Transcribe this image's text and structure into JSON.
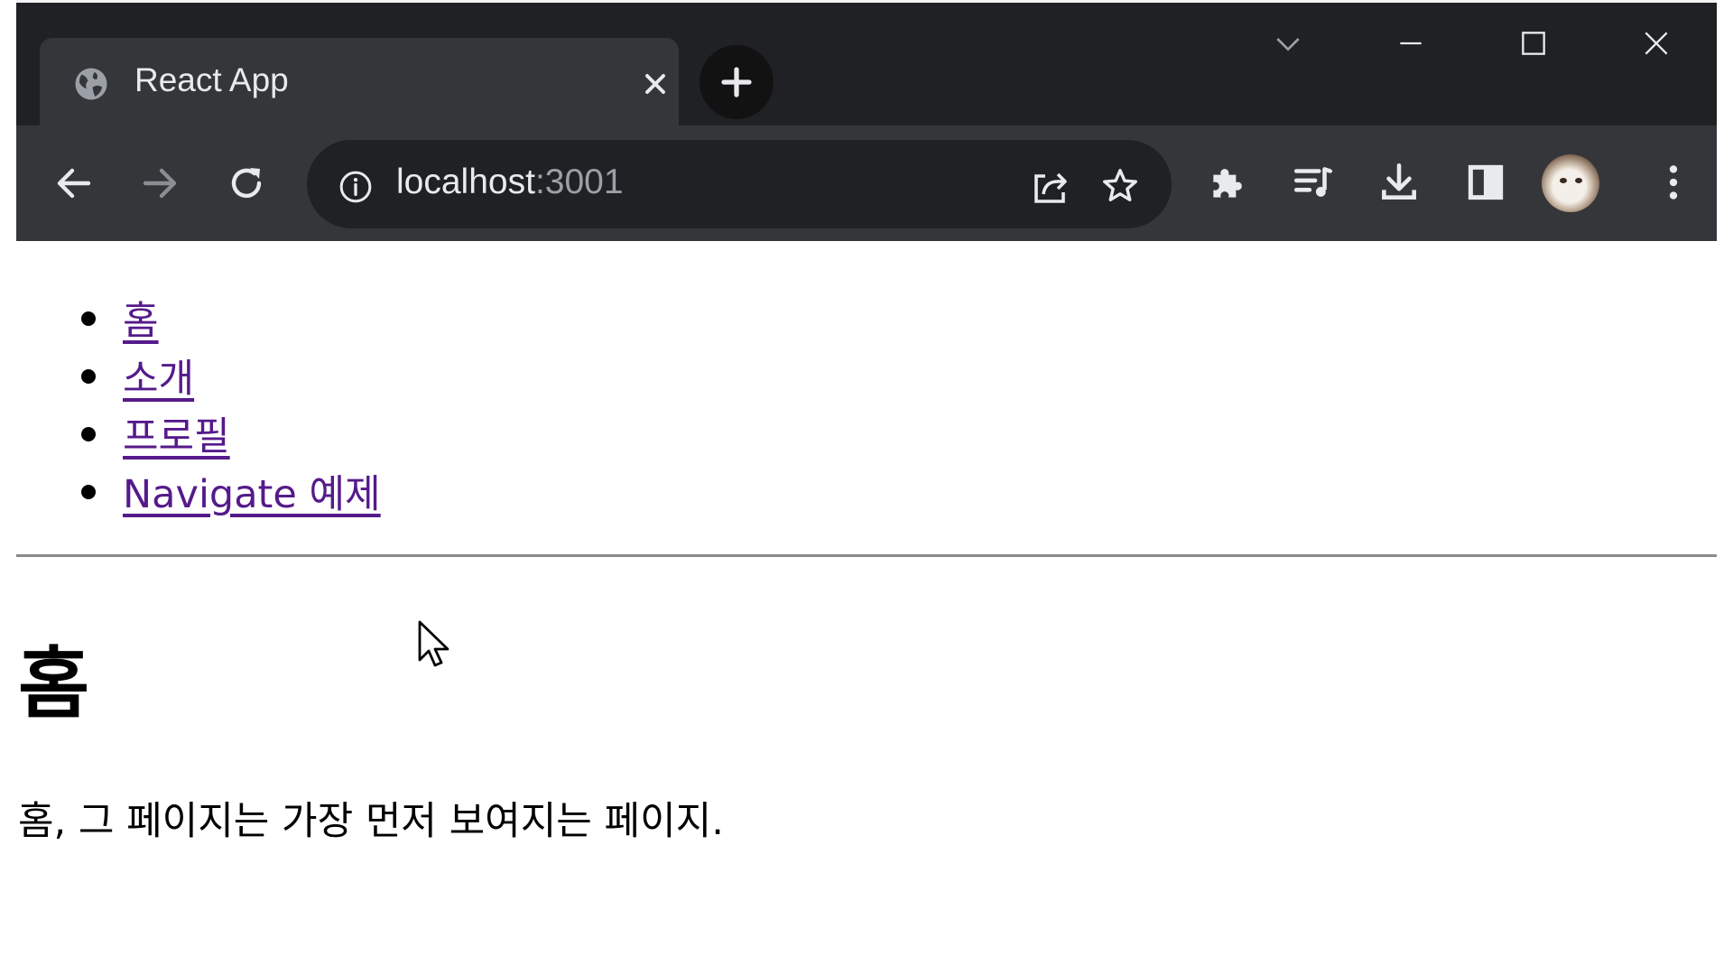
{
  "browser": {
    "tab": {
      "title": "React App",
      "favicon": "globe-icon"
    },
    "omnibox": {
      "url_host": "localhost",
      "url_port": ":3001"
    },
    "toolbar_icons": [
      "back-icon",
      "forward-icon",
      "reload-icon",
      "info-icon",
      "share-icon",
      "star-icon",
      "extensions-icon",
      "reading-list-icon",
      "download-icon",
      "side-panel-icon",
      "avatar",
      "menu-icon"
    ],
    "window_controls": [
      "tab-search-icon",
      "minimize-icon",
      "maximize-icon",
      "close-icon"
    ]
  },
  "page": {
    "nav": [
      {
        "label": "홈"
      },
      {
        "label": "소개"
      },
      {
        "label": "프로필"
      },
      {
        "label": "Navigate 예제"
      }
    ],
    "heading": "홈",
    "text": "홈, 그 페이지는 가장 먼저 보여지는 페이지."
  },
  "colors": {
    "titlebar": "#202124",
    "toolbar": "#35363a",
    "visited_link": "#551a8b",
    "divider": "#8a8a8a"
  }
}
